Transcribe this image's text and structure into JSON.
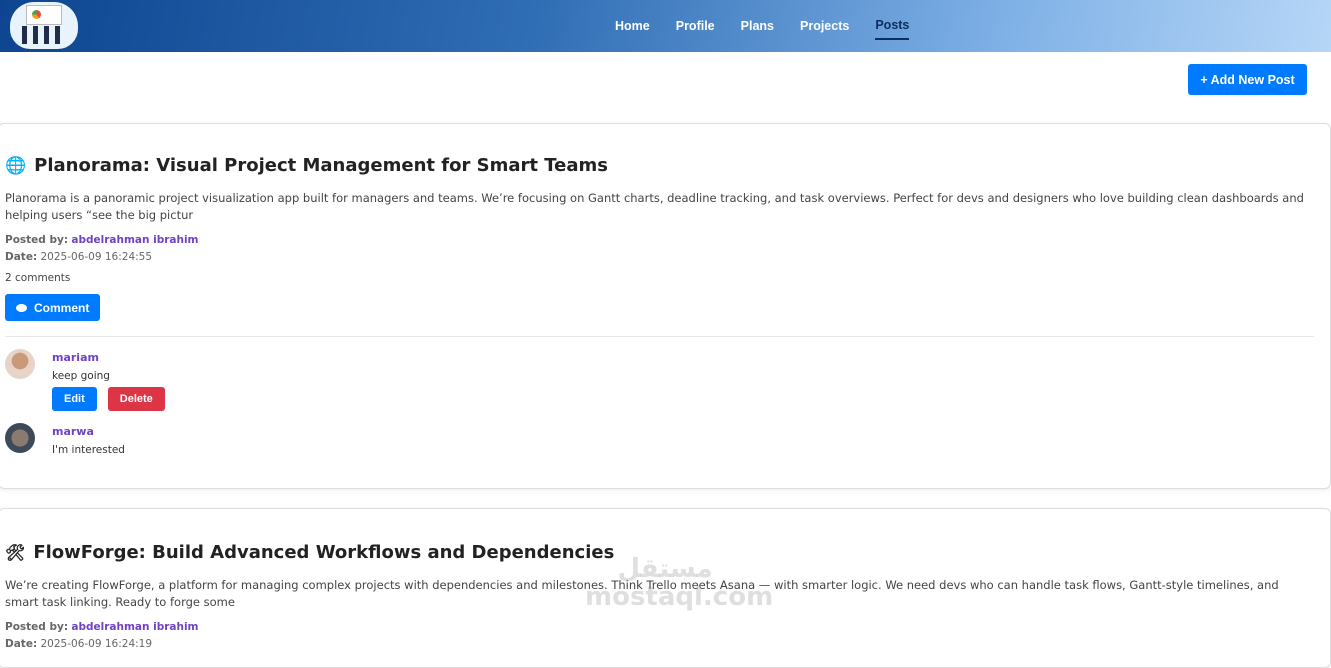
{
  "nav": {
    "items": [
      "Home",
      "Profile",
      "Plans",
      "Projects",
      "Posts"
    ],
    "active": "Posts"
  },
  "add_post": "+ Add New Post",
  "posts": [
    {
      "icon": "globe-icon",
      "title": "Planorama: Visual Project Management for Smart Teams",
      "description": "Planorama is a panoramic project visualization app built for managers and teams. We’re focusing on Gantt charts, deadline tracking, and task overviews. Perfect for devs and designers who love building clean dashboards and helping users “see the big pictur",
      "posted_by_label": "Posted by:",
      "author": "abdelrahman ibrahim",
      "date_label": "Date:",
      "date": "2025-06-09 16:24:55",
      "comment_count": "2 comments",
      "comment_button": "Comment",
      "comments": [
        {
          "name": "mariam",
          "text": "keep going",
          "edit": "Edit",
          "delete": "Delete"
        },
        {
          "name": "marwa",
          "text": "I'm interested"
        }
      ]
    },
    {
      "icon": "tools-icon",
      "title": "FlowForge: Build Advanced Workflows and Dependencies",
      "description": "We’re creating FlowForge, a platform for managing complex projects with dependencies and milestones. Think Trello meets Asana — with smarter logic. We need devs who can handle task flows, Gantt-style timelines, and smart task linking. Ready to forge some",
      "posted_by_label": "Posted by:",
      "author": "abdelrahman ibrahim",
      "date_label": "Date:",
      "date": "2025-06-09 16:24:19"
    }
  ],
  "watermark": "مستقل mostaql.com"
}
